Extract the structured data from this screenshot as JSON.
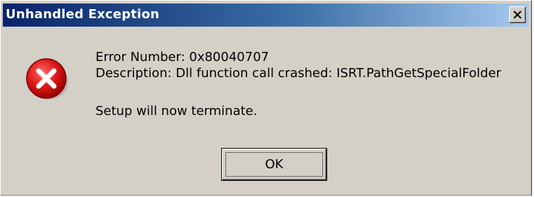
{
  "window": {
    "title": "Unhandled Exception",
    "title_gradient": [
      "#0a246a",
      "#a6caf0"
    ],
    "background": "#d4d0c8"
  },
  "titlebar": {
    "close_glyph": "close-icon"
  },
  "icon": {
    "name": "error-icon",
    "color": "#c8102e"
  },
  "message": {
    "error_number": "Error Number: 0x80040707",
    "description": "Description: Dll function call crashed: ISRT.PathGetSpecialFolder",
    "footer": "Setup will now terminate."
  },
  "buttons": {
    "ok_label": "OK"
  }
}
